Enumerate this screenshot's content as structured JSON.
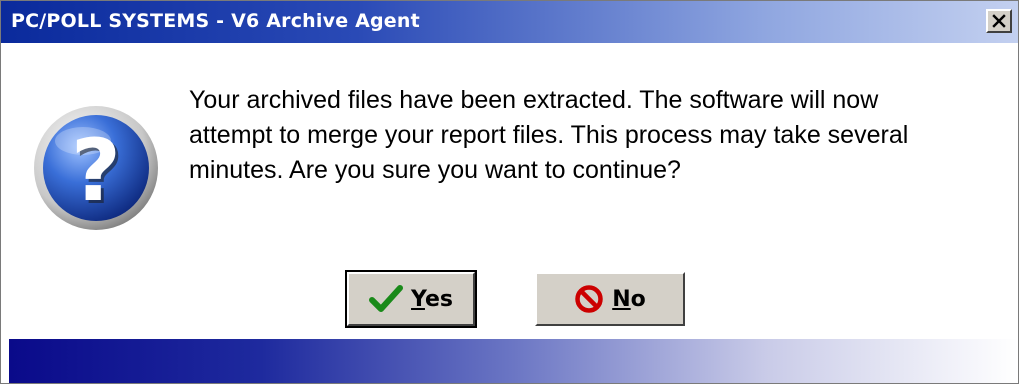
{
  "window": {
    "title": "PC/POLL SYSTEMS - V6 Archive Agent",
    "close_label": "×"
  },
  "icon": {
    "name": "question-icon"
  },
  "message": {
    "lines": [
      "Your archived files have been extracted.  The software will now",
      "attempt to merge your report files.  This process may take several",
      "minutes.  Are you sure you want to continue?"
    ]
  },
  "buttons": {
    "yes": {
      "accel": "Y",
      "rest": "es",
      "icon": "checkmark-icon",
      "icon_color": "#1a8a1a"
    },
    "no": {
      "accel": "N",
      "rest": "o",
      "icon": "no-entry-icon",
      "icon_color": "#cc0000"
    }
  },
  "colors": {
    "title_bar_start": "#0a2a9c",
    "bottom_bar_start": "#0a0a8a",
    "button_face": "#d4d0c8"
  }
}
